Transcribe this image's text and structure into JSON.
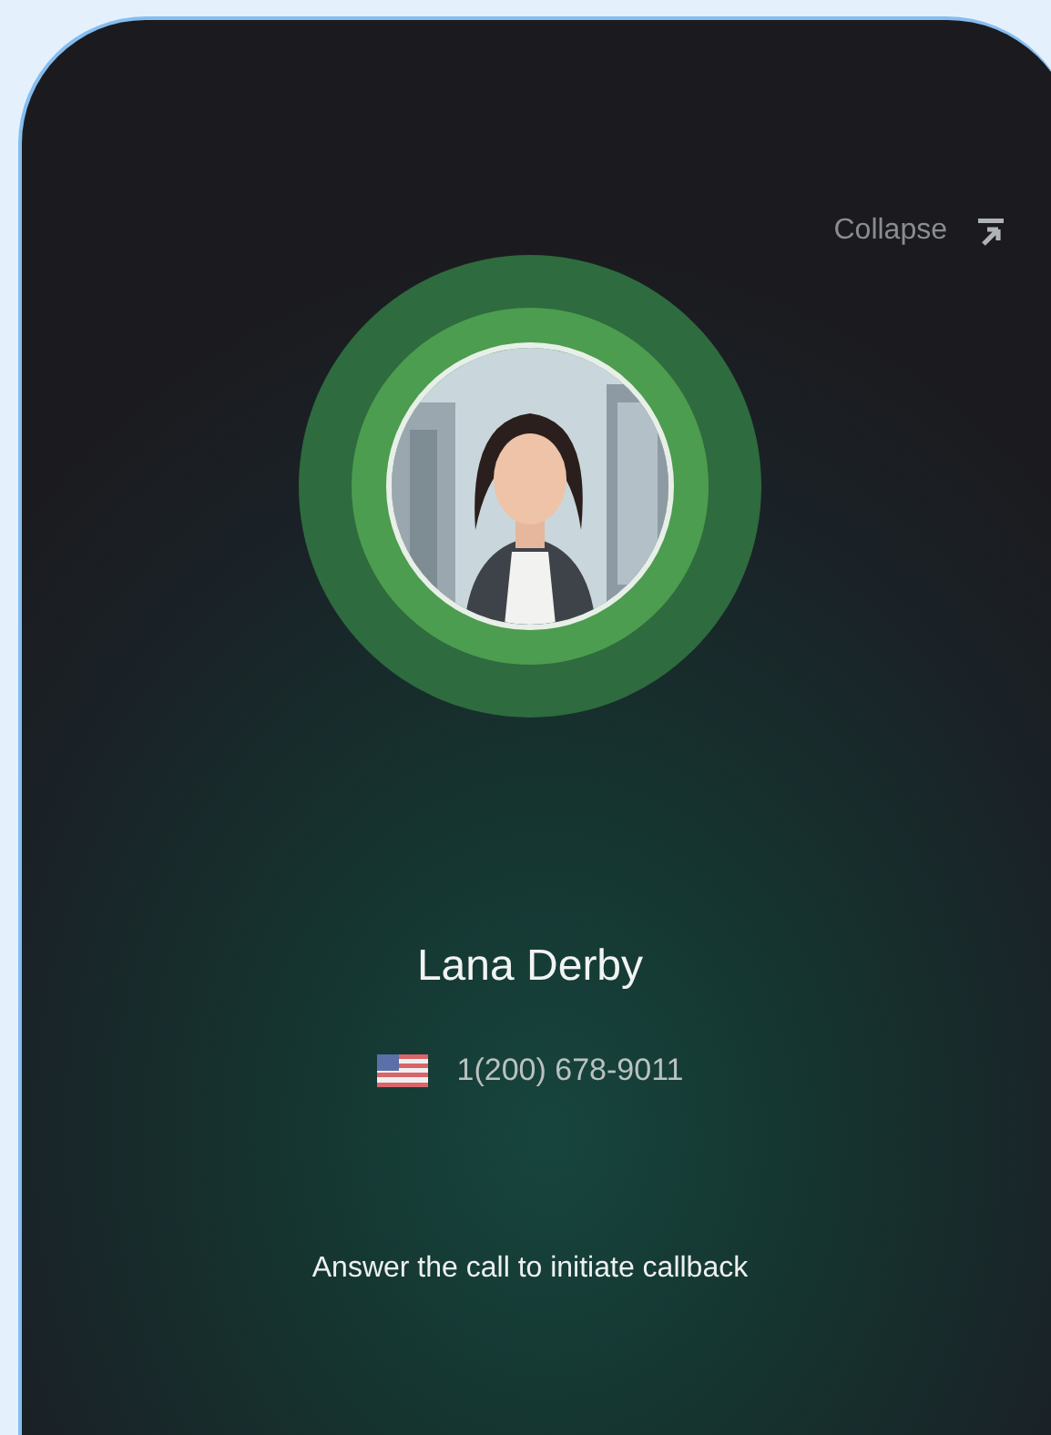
{
  "collapse": {
    "label": "Collapse"
  },
  "contact": {
    "name": "Lana Derby",
    "phone": "1(200) 678-9011"
  },
  "message": "Answer the call to initiate callback"
}
